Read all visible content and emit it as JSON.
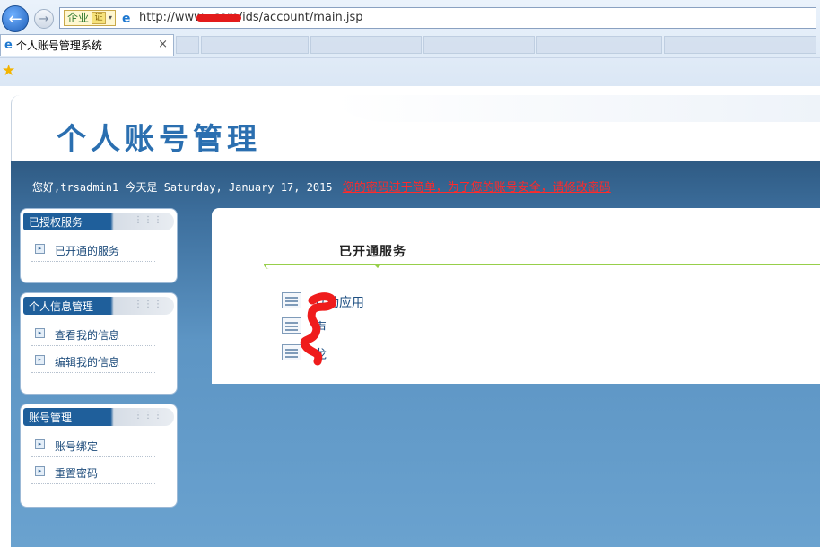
{
  "browser": {
    "badge_label": "企业",
    "cert_label": "证",
    "url": "http://www.  .com/ids/account/main.jsp",
    "tab_title": "个人账号管理系统",
    "tab_close": "×"
  },
  "header": {
    "title": "个人账号管理"
  },
  "welcome": {
    "text": "您好,trsadmin1 今天是 Saturday, January 17, 2015",
    "warning_link": "您的密码过于简单，为了您的账号安全，请修改密码"
  },
  "sidebar": [
    {
      "title": "已授权服务",
      "items": [
        "已开通的服务"
      ]
    },
    {
      "title": "个人信息管理",
      "items": [
        "查看我的信息",
        "编辑我的信息"
      ]
    },
    {
      "title": "账号管理",
      "items": [
        "账号绑定",
        "重置密码"
      ]
    }
  ],
  "main": {
    "section_title": "已开通服务",
    "services": [
      "互动应用",
      "声",
      "龙"
    ]
  },
  "colors": {
    "accent_blue": "#1f5f9b",
    "warning_red": "#ff2a2a",
    "rule_green": "#97cf4a"
  }
}
